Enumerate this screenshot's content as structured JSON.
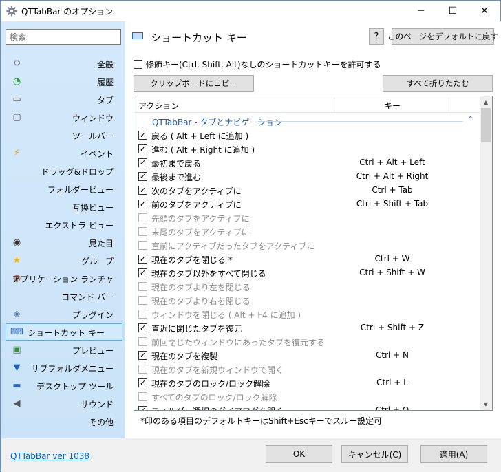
{
  "window": {
    "title": "QTTabBar のオプション",
    "icon": "gear-icon",
    "controls": {
      "minimize": "─",
      "maximize": "☐",
      "close": "✕"
    }
  },
  "sidebar": {
    "search_placeholder": "検索",
    "items": [
      {
        "label": "全般",
        "icon": "gear-icon",
        "glyph": "⚙",
        "color": "#6f7b86"
      },
      {
        "label": "履歴",
        "icon": "history-icon",
        "glyph": "◔",
        "color": "#2f9a3d"
      },
      {
        "label": "タブ",
        "icon": "tab-icon",
        "glyph": "▭",
        "color": "#666666"
      },
      {
        "label": "ウィンドウ",
        "icon": "window-icon",
        "glyph": "▢",
        "color": "#555555"
      },
      {
        "label": "ツールバー",
        "icon": "",
        "glyph": "",
        "color": "#000000"
      },
      {
        "label": "イベント",
        "icon": "lightning-icon",
        "glyph": "⚡",
        "color": "#e2a800"
      },
      {
        "label": "ドラッグ&ドロップ",
        "icon": "",
        "glyph": "",
        "color": "#000000"
      },
      {
        "label": "フォルダービュー",
        "icon": "",
        "glyph": "",
        "color": "#000000"
      },
      {
        "label": "互換ビュー",
        "icon": "",
        "glyph": "",
        "color": "#000000"
      },
      {
        "label": "エクストラ ビュー",
        "icon": "",
        "glyph": "",
        "color": "#000000"
      },
      {
        "label": "見た目",
        "icon": "eye-icon",
        "glyph": "◉",
        "color": "#333333"
      },
      {
        "label": "グループ",
        "icon": "star-icon",
        "glyph": "★",
        "color": "#f0b400"
      },
      {
        "label": "アプリケーション ランチャ",
        "icon": "launcher-icon",
        "glyph": "◍",
        "color": "#d04a1e"
      },
      {
        "label": "コマンド バー",
        "icon": "",
        "glyph": "",
        "color": "#000000"
      },
      {
        "label": "プラグイン",
        "icon": "plugin-icon",
        "glyph": "◈",
        "color": "#4a6fa5"
      },
      {
        "label": "ショートカット キー",
        "icon": "keyboard-icon",
        "glyph": "⌨",
        "color": "#2a66b8",
        "selected": true
      },
      {
        "label": "プレビュー",
        "icon": "preview-icon",
        "glyph": "▣",
        "color": "#3a8a3a"
      },
      {
        "label": "サブフォルダメニュー",
        "icon": "subfolder-menu-icon",
        "glyph": "▼",
        "color": "#1e5fb4"
      },
      {
        "label": "デスクトップ ツール",
        "icon": "desktop-icon",
        "glyph": "▬",
        "color": "#2a66b8"
      },
      {
        "label": "サウンド",
        "icon": "speaker-icon",
        "glyph": "◀",
        "color": "#555555"
      },
      {
        "label": "その他",
        "icon": "",
        "glyph": "",
        "color": "#000000"
      }
    ]
  },
  "panel": {
    "title": "ショートカット キー",
    "help_label": "?",
    "default_label": "このページをデフォルトに戻す",
    "allow_no_modifier": "修飾キー(Ctrl, Shift, Alt)なしのショートカットキーを許可する",
    "copy_label": "クリップボードにコピー",
    "collapse_label": "すべて折りたたむ",
    "columns": {
      "action": "アクション",
      "key": "キー"
    },
    "group_label": "QTTabBar - タブとナビゲーション",
    "rows": [
      {
        "label": "戻る ( Alt + Left に追加 )",
        "key": "",
        "checked": true
      },
      {
        "label": "進む ( Alt + Right に追加 )",
        "key": "",
        "checked": true
      },
      {
        "label": "最初まで戻る",
        "key": "Ctrl + Alt + Left",
        "checked": true
      },
      {
        "label": "最後まで進む",
        "key": "Ctrl + Alt + Right",
        "checked": true
      },
      {
        "label": "次のタブをアクティブに",
        "key": "Ctrl + Tab",
        "checked": true
      },
      {
        "label": "前のタブをアクティブに",
        "key": "Ctrl + Shift + Tab",
        "checked": true
      },
      {
        "label": "先頭のタブをアクティブに",
        "key": "",
        "checked": false
      },
      {
        "label": "末尾のタブをアクティブに",
        "key": "",
        "checked": false
      },
      {
        "label": "直前にアクティブだったタブをアクティブに",
        "key": "",
        "checked": false
      },
      {
        "label": "現在のタブを閉じる *",
        "key": "Ctrl + W",
        "checked": true
      },
      {
        "label": "現在のタブ以外をすべて閉じる",
        "key": "Ctrl + Shift + W",
        "checked": true
      },
      {
        "label": "現在のタブより左を閉じる",
        "key": "",
        "checked": false
      },
      {
        "label": "現在のタブより右を閉じる",
        "key": "",
        "checked": false
      },
      {
        "label": "ウィンドウを閉じる ( Alt + F4 に追加 )",
        "key": "",
        "checked": false
      },
      {
        "label": "直近に閉じたタブを復元",
        "key": "Ctrl + Shift + Z",
        "checked": true
      },
      {
        "label": "前回閉じたウィンドウにあったタブを復元する",
        "key": "",
        "checked": false
      },
      {
        "label": "現在のタブを複製",
        "key": "Ctrl + N",
        "checked": true
      },
      {
        "label": "現在のタブを新規ウィンドウで開く",
        "key": "",
        "checked": false
      },
      {
        "label": "現在のタブのロック/ロック解除",
        "key": "Ctrl + L",
        "checked": true
      },
      {
        "label": "すべてのタブのロック/ロック解除",
        "key": "",
        "checked": false
      },
      {
        "label": "フォルダー選択のダイアログを開く",
        "key": "Ctrl + O",
        "checked": true
      }
    ],
    "footnote": "*印のある項目のデフォルトキーはShift+Escキーでスルー設定可"
  },
  "bottom": {
    "version": "QTTabBar ver 1038",
    "ok": "OK",
    "cancel": "キャンセル(C)",
    "apply": "適用(A)"
  }
}
